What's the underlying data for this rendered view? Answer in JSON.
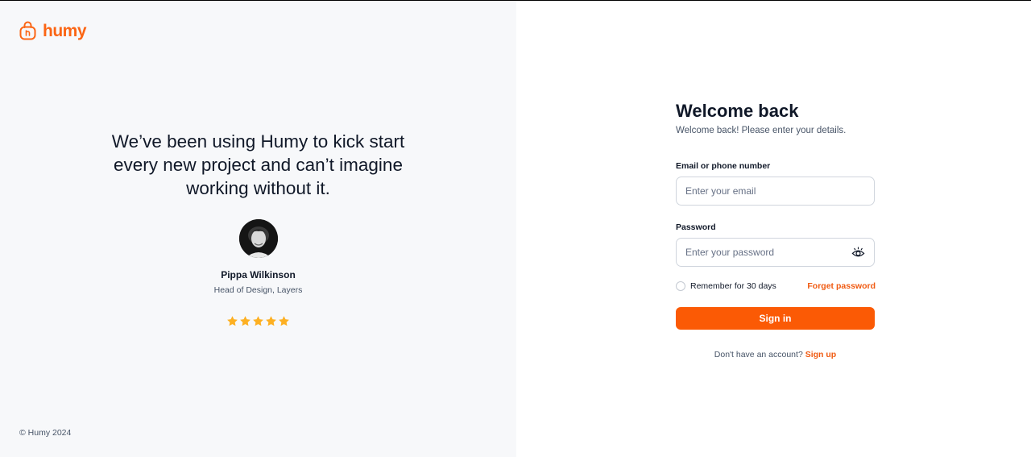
{
  "brand": {
    "name": "humy",
    "color": "#fb6514",
    "icon": "shopping-bag-icon"
  },
  "testimonial": {
    "quote": "We’ve been using Humy to kick start every new project and can’t imagine working without it.",
    "name": "Pippa Wilkinson",
    "role": "Head of Design, Layers",
    "rating": 5,
    "rating_max": 5,
    "star_color": "#fdb022"
  },
  "footer": {
    "copyright": "© Humy 2024"
  },
  "login": {
    "title": "Welcome back",
    "subtitle": "Welcome back! Please enter your details.",
    "email_label": "Email or phone number",
    "email_placeholder": "Enter your email",
    "email_value": "",
    "password_label": "Password",
    "password_placeholder": "Enter your password",
    "password_value": "",
    "password_toggle_icon": "eye-icon",
    "remember_label": "Remember for 30 days",
    "remember_checked": false,
    "forgot_label": "Forget password",
    "signin_label": "Sign in",
    "signup_prompt": "Don't have an account?",
    "signup_label": "Sign up",
    "accent_color": "#fb5a05"
  }
}
